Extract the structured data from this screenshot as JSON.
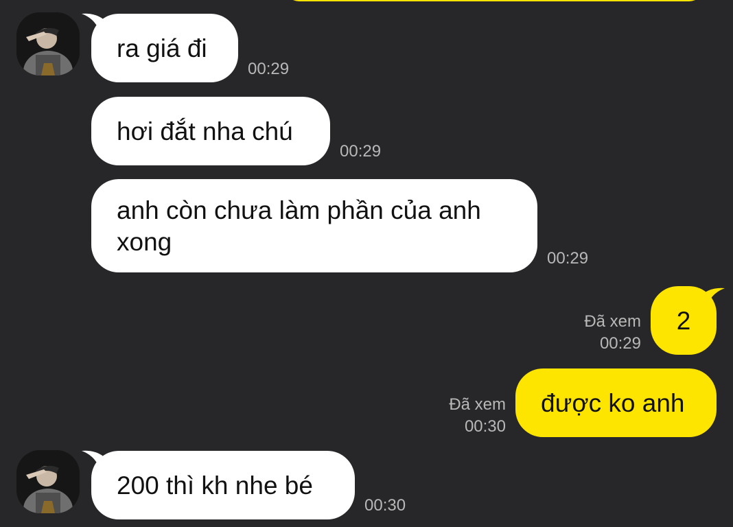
{
  "colors": {
    "background": "#272729",
    "incoming_bubble": "#ffffff",
    "outgoing_bubble": "#FEE500",
    "meta_text": "#b8b8b8"
  },
  "messages": [
    {
      "direction": "in",
      "text": "ra giá đi",
      "time": "00:29"
    },
    {
      "direction": "in",
      "text": "hơi đắt nha chú",
      "time": "00:29"
    },
    {
      "direction": "in",
      "text": "anh còn chưa làm phần của anh xong",
      "time": "00:29"
    },
    {
      "direction": "out",
      "text": "2",
      "status": "Đã xem",
      "time": "00:29"
    },
    {
      "direction": "out",
      "text": "được ko anh",
      "status": "Đã xem",
      "time": "00:30"
    },
    {
      "direction": "in",
      "text": "200 thì kh nhe bé",
      "time": "00:30"
    }
  ]
}
